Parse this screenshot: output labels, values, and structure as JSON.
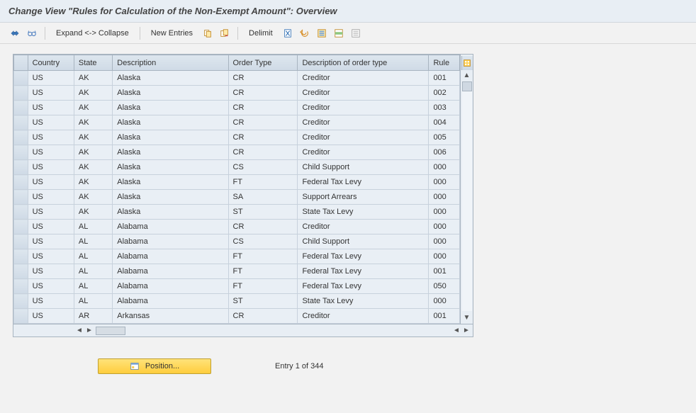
{
  "title": "Change View \"Rules for Calculation of the Non-Exempt Amount\": Overview",
  "toolbar": {
    "expand_collapse": "Expand <-> Collapse",
    "new_entries": "New Entries",
    "delimit": "Delimit"
  },
  "table": {
    "columns": [
      "Country",
      "State",
      "Description",
      "Order Type",
      "Description of order type",
      "Rule"
    ],
    "widths": [
      60,
      50,
      150,
      90,
      170,
      40
    ],
    "rows": [
      {
        "country": "US",
        "state": "AK",
        "desc": "Alaska",
        "otype": "CR",
        "odesc": "Creditor",
        "rule": "001"
      },
      {
        "country": "US",
        "state": "AK",
        "desc": "Alaska",
        "otype": "CR",
        "odesc": "Creditor",
        "rule": "002"
      },
      {
        "country": "US",
        "state": "AK",
        "desc": "Alaska",
        "otype": "CR",
        "odesc": "Creditor",
        "rule": "003"
      },
      {
        "country": "US",
        "state": "AK",
        "desc": "Alaska",
        "otype": "CR",
        "odesc": "Creditor",
        "rule": "004"
      },
      {
        "country": "US",
        "state": "AK",
        "desc": "Alaska",
        "otype": "CR",
        "odesc": "Creditor",
        "rule": "005"
      },
      {
        "country": "US",
        "state": "AK",
        "desc": "Alaska",
        "otype": "CR",
        "odesc": "Creditor",
        "rule": "006"
      },
      {
        "country": "US",
        "state": "AK",
        "desc": "Alaska",
        "otype": "CS",
        "odesc": "Child Support",
        "rule": "000"
      },
      {
        "country": "US",
        "state": "AK",
        "desc": "Alaska",
        "otype": "FT",
        "odesc": "Federal Tax Levy",
        "rule": "000"
      },
      {
        "country": "US",
        "state": "AK",
        "desc": "Alaska",
        "otype": "SA",
        "odesc": "Support Arrears",
        "rule": "000"
      },
      {
        "country": "US",
        "state": "AK",
        "desc": "Alaska",
        "otype": "ST",
        "odesc": "State Tax Levy",
        "rule": "000"
      },
      {
        "country": "US",
        "state": "AL",
        "desc": "Alabama",
        "otype": "CR",
        "odesc": "Creditor",
        "rule": "000"
      },
      {
        "country": "US",
        "state": "AL",
        "desc": "Alabama",
        "otype": "CS",
        "odesc": "Child Support",
        "rule": "000"
      },
      {
        "country": "US",
        "state": "AL",
        "desc": "Alabama",
        "otype": "FT",
        "odesc": "Federal Tax Levy",
        "rule": "000"
      },
      {
        "country": "US",
        "state": "AL",
        "desc": "Alabama",
        "otype": "FT",
        "odesc": "Federal Tax Levy",
        "rule": "001"
      },
      {
        "country": "US",
        "state": "AL",
        "desc": "Alabama",
        "otype": "FT",
        "odesc": "Federal Tax Levy",
        "rule": "050"
      },
      {
        "country": "US",
        "state": "AL",
        "desc": "Alabama",
        "otype": "ST",
        "odesc": "State Tax Levy",
        "rule": "000"
      },
      {
        "country": "US",
        "state": "AR",
        "desc": "Arkansas",
        "otype": "CR",
        "odesc": "Creditor",
        "rule": "001"
      }
    ]
  },
  "footer": {
    "position_label": "Position...",
    "entry_text": "Entry 1 of 344"
  }
}
